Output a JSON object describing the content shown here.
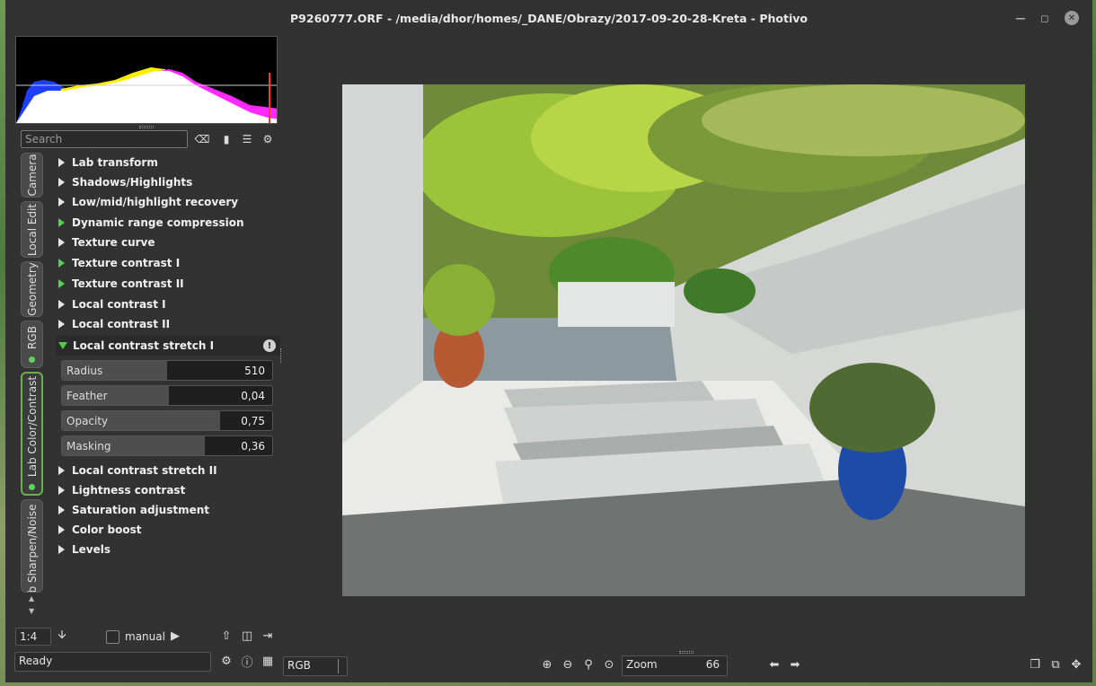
{
  "window": {
    "title": "P9260777.ORF - /media/dhor/homes/_DANE/Obrazy/2017-09-20-28-Kreta - Photivo"
  },
  "search": {
    "placeholder": "Search"
  },
  "tabs": [
    {
      "label": "Camera"
    },
    {
      "label": "Local Edit"
    },
    {
      "label": "Geometry"
    },
    {
      "label": "RGB"
    },
    {
      "label": "Lab Color/Contrast"
    },
    {
      "label": "Lab Sharpen/Noise"
    }
  ],
  "sections": [
    {
      "label": "Lab transform",
      "active": false
    },
    {
      "label": "Shadows/Highlights",
      "active": false
    },
    {
      "label": "Low/mid/highlight recovery",
      "active": false
    },
    {
      "label": "Dynamic range compression",
      "active": true
    },
    {
      "label": "Texture curve",
      "active": false
    },
    {
      "label": "Texture contrast I",
      "active": true
    },
    {
      "label": "Texture contrast II",
      "active": true
    },
    {
      "label": "Local contrast I",
      "active": false
    },
    {
      "label": "Local contrast II",
      "active": false
    }
  ],
  "open_section": {
    "label": "Local contrast stretch I",
    "sliders": [
      {
        "label": "Radius",
        "value": "510",
        "fraction": 0.5
      },
      {
        "label": "Feather",
        "value": "0,04",
        "fraction": 0.51
      },
      {
        "label": "Opacity",
        "value": "0,75",
        "fraction": 0.75
      },
      {
        "label": "Masking",
        "value": "0,36",
        "fraction": 0.68
      }
    ]
  },
  "sections_after": [
    {
      "label": "Local contrast stretch II",
      "active": false
    },
    {
      "label": "Lightness contrast",
      "active": false
    },
    {
      "label": "Saturation adjustment",
      "active": false
    },
    {
      "label": "Color boost",
      "active": false
    },
    {
      "label": "Levels",
      "active": false
    }
  ],
  "bottom": {
    "scale": "1:4",
    "manual_label": "manual",
    "status": "Ready",
    "colorspace": "RGB",
    "zoom_label": "Zoom",
    "zoom_value": "66"
  },
  "colors": {
    "accent": "#6cae54",
    "active_arrow": "#53d153",
    "background": "#323232"
  }
}
